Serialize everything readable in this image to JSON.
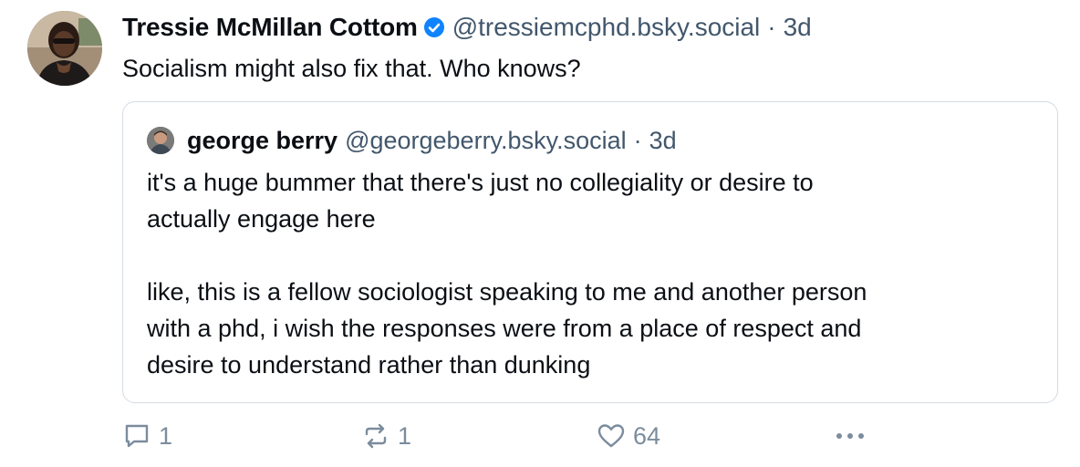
{
  "post": {
    "author": {
      "display_name": "Tressie McMillan Cottom",
      "handle": "@tressiemcphd.bsky.social",
      "verified_icon": "verified-check-icon",
      "accent_color": "#1083fe"
    },
    "separator": "·",
    "timestamp": "3d",
    "text": "Socialism might also fix that. Who knows?",
    "quote": {
      "author": {
        "display_name": "george berry",
        "handle": "@georgeberry.bsky.social"
      },
      "separator": "·",
      "timestamp": "3d",
      "paragraphs": [
        "it's a huge bummer that there's just no collegiality or desire to",
        "actually engage here",
        "like, this is a fellow sociologist speaking to me and another person",
        "with a phd, i wish the responses were from a place of respect and",
        "desire to understand rather than dunking"
      ]
    },
    "actions": {
      "reply_count": "1",
      "repost_count": "1",
      "like_count": "64",
      "reply_icon": "speech-bubble-icon",
      "repost_icon": "repost-arrows-icon",
      "like_icon": "heart-icon",
      "more_icon": "ellipsis-icon"
    }
  }
}
